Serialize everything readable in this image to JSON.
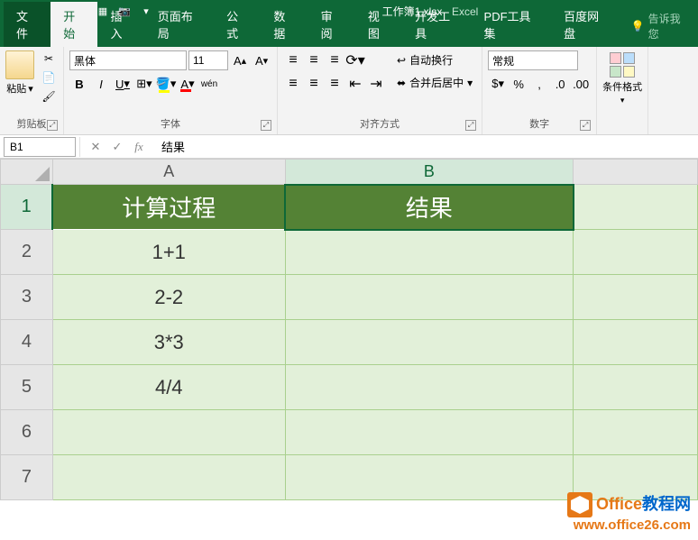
{
  "title": {
    "filename": "工作簿1.xlsx",
    "app": "Excel",
    "sep": " - "
  },
  "tabs": {
    "file": "文件",
    "home": "开始",
    "insert": "插入",
    "layout": "页面布局",
    "formula": "公式",
    "data": "数据",
    "review": "审阅",
    "view": "视图",
    "dev": "开发工具",
    "pdf": "PDF工具集",
    "baidu": "百度网盘",
    "tellme": "告诉我您"
  },
  "ribbon": {
    "clipboard": {
      "paste": "粘贴",
      "label": "剪贴板"
    },
    "font": {
      "name": "黑体",
      "size": "11",
      "bold": "B",
      "italic": "I",
      "underline": "U",
      "label": "字体",
      "wen": "wén"
    },
    "align": {
      "wrap": "自动换行",
      "merge": "合并后居中",
      "label": "对齐方式"
    },
    "number": {
      "format": "常规",
      "label": "数字"
    },
    "cond": {
      "label": "条件格式"
    }
  },
  "formula_bar": {
    "cell_ref": "B1",
    "value": "结果"
  },
  "sheet": {
    "col_headers": [
      "A",
      "B"
    ],
    "row_headers": [
      "1",
      "2",
      "3",
      "4",
      "5",
      "6",
      "7"
    ],
    "header_row": {
      "A": "计算过程",
      "B": "结果"
    },
    "data_rows": [
      {
        "A": "1+1",
        "B": ""
      },
      {
        "A": "2-2",
        "B": ""
      },
      {
        "A": "3*3",
        "B": ""
      },
      {
        "A": "4/4",
        "B": ""
      }
    ]
  },
  "watermark": {
    "line1a": "Office",
    "line1b": "教程网",
    "line2": "www.office26.com"
  }
}
